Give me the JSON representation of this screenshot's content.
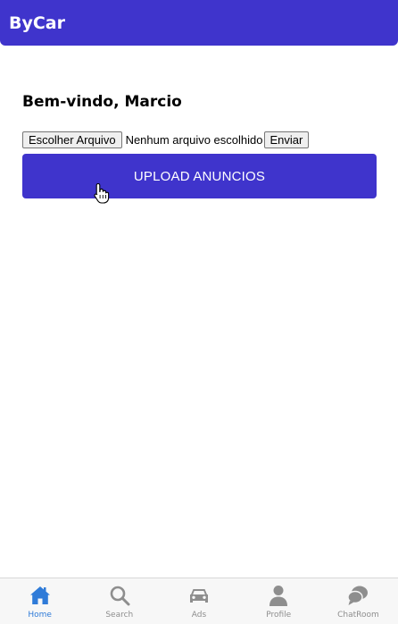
{
  "header": {
    "title": "ByCar"
  },
  "main": {
    "welcome": "Bem-vindo, Marcio",
    "file_input": {
      "choose_label": "Escolher Arquivo",
      "status": "Nenhum arquivo escolhido",
      "submit_label": "Enviar"
    },
    "upload_button": "UPLOAD ANUNCIOS"
  },
  "bottom_nav": {
    "items": [
      {
        "label": "Home",
        "icon": "home-icon",
        "active": true
      },
      {
        "label": "Search",
        "icon": "search-icon"
      },
      {
        "label": "Ads",
        "icon": "car-icon"
      },
      {
        "label": "Profile",
        "icon": "person-icon"
      },
      {
        "label": "ChatRoom",
        "icon": "chat-icon"
      }
    ]
  },
  "colors": {
    "brand": "#3f34cc",
    "nav_active": "#2f7bd8",
    "nav_inactive": "#8e8e8e"
  }
}
